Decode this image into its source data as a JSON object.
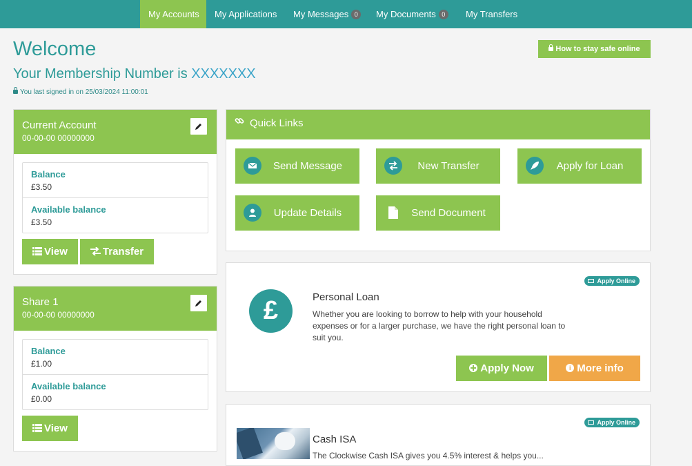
{
  "nav": {
    "items": [
      {
        "label": "My Accounts",
        "badge": null,
        "active": true
      },
      {
        "label": "My Applications",
        "badge": null,
        "active": false
      },
      {
        "label": "My Messages",
        "badge": "0",
        "active": false
      },
      {
        "label": "My Documents",
        "badge": "0",
        "active": false
      },
      {
        "label": "My Transfers",
        "badge": null,
        "active": false
      }
    ]
  },
  "header": {
    "welcome": "Welcome",
    "membership_prefix": "Your Membership Number is ",
    "membership_number": "XXXXXXX",
    "last_signed_in": "You last signed in on 25/03/2024 11:00:01",
    "safe_button": "How to stay safe online"
  },
  "accounts": [
    {
      "title": "Current Account",
      "number": "00-00-00 00000000",
      "balance_label": "Balance",
      "balance": "£3.50",
      "available_label": "Available balance",
      "available": "£3.50",
      "view_label": "View",
      "transfer_label": "Transfer"
    },
    {
      "title": "Share 1",
      "number": "00-00-00 00000000",
      "balance_label": "Balance",
      "balance": "£1.00",
      "available_label": "Available balance",
      "available": "£0.00",
      "view_label": "View"
    }
  ],
  "quick_links": {
    "title": "Quick Links",
    "items": [
      {
        "label": "Send Message",
        "icon": "envelope-icon"
      },
      {
        "label": "New Transfer",
        "icon": "exchange-icon"
      },
      {
        "label": "Apply for Loan",
        "icon": "rocket-icon"
      },
      {
        "label": "Update Details",
        "icon": "user-icon"
      },
      {
        "label": "Send Document",
        "icon": "document-icon"
      }
    ]
  },
  "products": [
    {
      "badge": "Apply Online",
      "title": "Personal Loan",
      "description": "Whether you are looking to borrow to help with your household expenses or for a larger purchase, we have the right personal loan to suit you.",
      "icon_text": "£",
      "apply_label": "Apply Now",
      "more_label": "More info"
    },
    {
      "badge": "Apply Online",
      "title": "Cash ISA",
      "description": "The Clockwise Cash ISA gives you 4.5% interest & helps you..."
    }
  ],
  "colors": {
    "teal": "#2e9b98",
    "green": "#8dc550",
    "orange": "#f0a748"
  }
}
